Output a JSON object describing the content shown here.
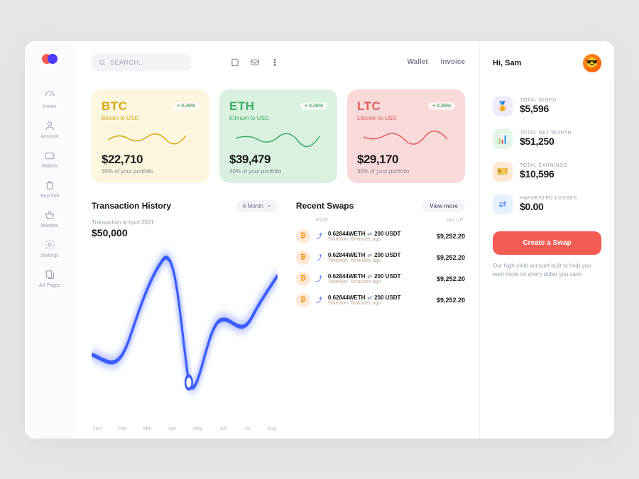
{
  "search_placeholder": "SEARCH..",
  "toplinks": {
    "wallet": "Wallet",
    "invoice": "Invoice"
  },
  "sidebar": {
    "items": [
      {
        "label": "Home"
      },
      {
        "label": "Account"
      },
      {
        "label": "Wallets"
      },
      {
        "label": "Buy/Sell"
      },
      {
        "label": "Markets"
      },
      {
        "label": "Settings"
      },
      {
        "label": "Ad Pages"
      }
    ]
  },
  "cards": [
    {
      "ticker": "BTC",
      "change": "+ 0.26%",
      "pair": "Bitcoin to USD",
      "price": "$22,710",
      "portfolio": "30% of your portfolio"
    },
    {
      "ticker": "ETH",
      "change": "+ 0.26%",
      "pair": "Ethrium to USD",
      "price": "$39,479",
      "portfolio": "40% of your portfolio"
    },
    {
      "ticker": "LTC",
      "change": "+ 0.26%",
      "pair": "Litecoin to USD",
      "price": "$29,170",
      "portfolio": "30% of your portfolio"
    }
  ],
  "history": {
    "title": "Transaction History",
    "period": "6 Month",
    "subtitle": "Transaction in April 2021",
    "amount": "$50,000",
    "months": [
      "Jan",
      "Feb",
      "Mar",
      "Apr",
      "May",
      "Jun",
      "Jul",
      "Aug"
    ]
  },
  "swaps": {
    "title": "Recent Swaps",
    "viewmore": "View more",
    "col_pair": "PAIR",
    "col_value": "VALUE",
    "rows": [
      {
        "pair_left": "0.62844WETH",
        "pair_right": "200 USDT",
        "meta": "Tokenlon· 6minutes ago",
        "value": "$9,252.20"
      },
      {
        "pair_left": "0.62844WETH",
        "pair_right": "200 USDT",
        "meta": "Tokenlon· 6minutes ago",
        "value": "$9,252.20"
      },
      {
        "pair_left": "0.62844WETH",
        "pair_right": "200 USDT",
        "meta": "Tokenlon· 6minutes ago",
        "value": "$9,252.20"
      },
      {
        "pair_left": "0.62844WETH",
        "pair_right": "200 USDT",
        "meta": "Tokenlon· 6minutes ago",
        "value": "$9,252.20"
      }
    ]
  },
  "user": {
    "greeting": "Hi, Sam"
  },
  "stats": [
    {
      "label": "TOTAL MINED",
      "value": "$5,596"
    },
    {
      "label": "TOTAL NET WORTH",
      "value": "$51,250"
    },
    {
      "label": "TOTAL EARNINGS",
      "value": "$10,596"
    },
    {
      "label": "HARVESTED LOSSES",
      "value": "$0.00"
    }
  ],
  "cta": "Create a Swap",
  "note": "Our high-yield account built to help you earn more on every dollar you save",
  "chart_data": {
    "type": "line",
    "title": "Transaction History",
    "xlabel": "",
    "ylabel": "",
    "x": [
      "Jan",
      "Feb",
      "Mar",
      "Apr",
      "May",
      "Jun",
      "Jul",
      "Aug"
    ],
    "values": [
      26000,
      22000,
      32000,
      57000,
      20000,
      42000,
      38000,
      52000
    ],
    "highlight": {
      "x": "May",
      "value": 20000,
      "label": "Transaction in April 2021",
      "amount": 50000
    },
    "ylim": [
      0,
      60000
    ]
  }
}
